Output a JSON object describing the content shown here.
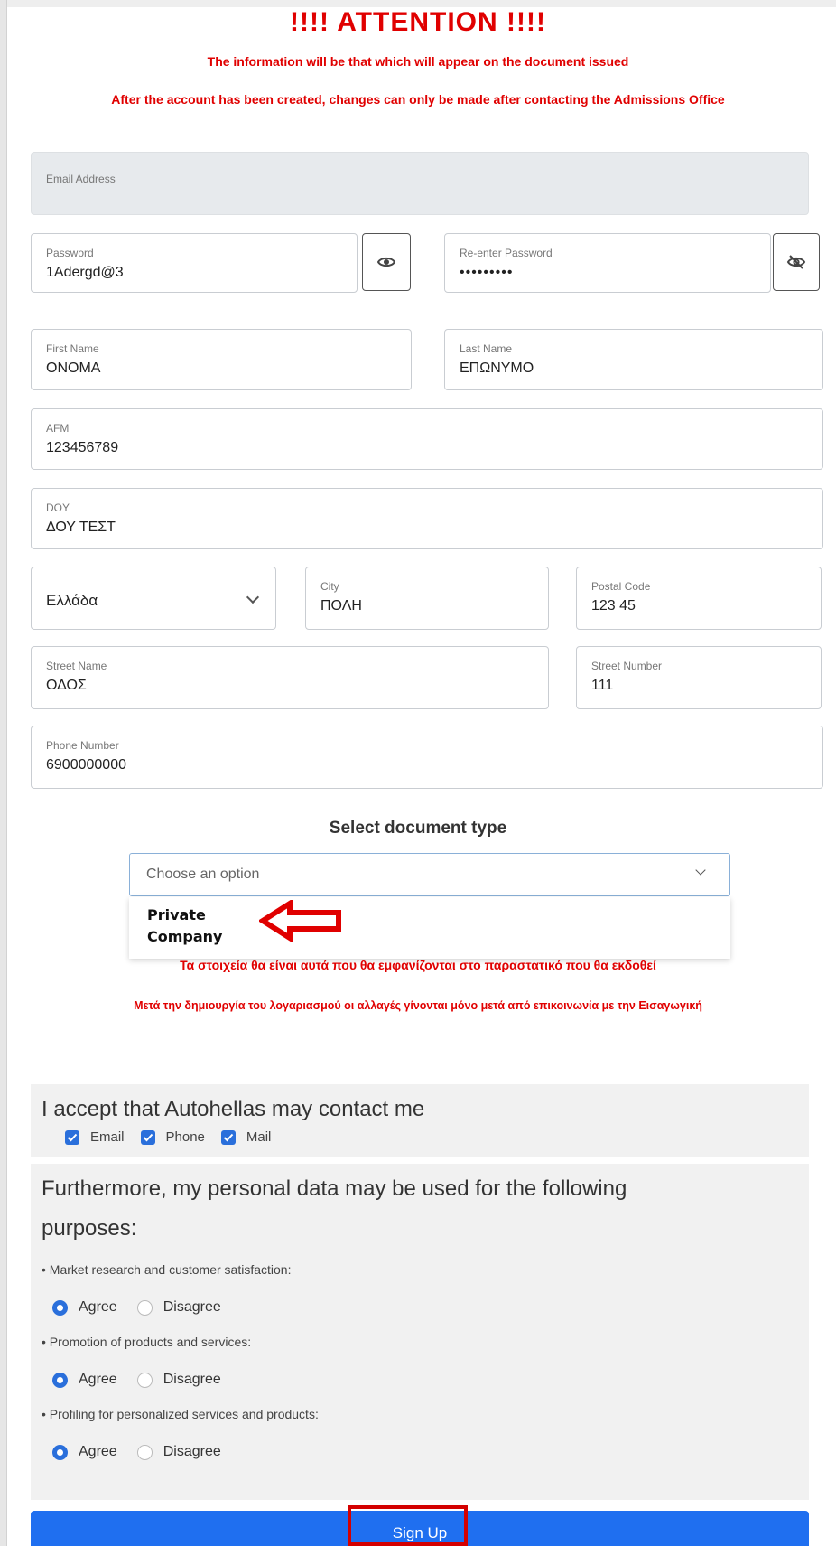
{
  "header": {
    "attention": "!!!!   ATTENTION   !!!!",
    "warning_info": "The information will be that which will appear on the document issued",
    "warning_changes": "After the account has been created, changes can only be made after contacting the Admissions Office"
  },
  "form": {
    "email": {
      "label": "Email Address",
      "value": ""
    },
    "password": {
      "label": "Password",
      "value": "1Adergd@3"
    },
    "reenter_password": {
      "label": "Re-enter Password",
      "value": "•••••••••"
    },
    "first_name": {
      "label": "First Name",
      "value": "ONOMA"
    },
    "last_name": {
      "label": "Last Name",
      "value": "ΕΠΩΝΥΜΟ"
    },
    "afm": {
      "label": "AFM",
      "value": "123456789"
    },
    "doy": {
      "label": "DOY",
      "value": "ΔΟΥ ΤΕΣΤ"
    },
    "country": {
      "value": "Ελλάδα"
    },
    "city": {
      "label": "City",
      "value": "ΠΟΛΗ"
    },
    "postal_code": {
      "label": "Postal Code",
      "value": "123 45"
    },
    "street_name": {
      "label": "Street Name",
      "value": "ΟΔΟΣ"
    },
    "street_number": {
      "label": "Street Number",
      "value": "111"
    },
    "phone": {
      "label": "Phone Number",
      "value": "6900000000"
    }
  },
  "document_type": {
    "title": "Select document type",
    "placeholder": "Choose an option",
    "option_line1": "Private",
    "option_line2": "Company"
  },
  "greek_warnings": {
    "line1": "Τα στοιχεία θα είναι αυτά που θα εμφανίζονται στο παραστατικό που θα εκδοθεί",
    "line2": "Μετά την δημιουργία του λογαριασμού οι αλλαγές γίνονται μόνο μετά από επικοινωνία με την Εισαγωγική"
  },
  "contact_consent": {
    "title": "I accept that Autohellas may contact me",
    "options": [
      "Email",
      "Phone",
      "Mail"
    ]
  },
  "data_usage": {
    "title_line1": "Furthermore, my personal data may be used for the following",
    "title_line2": "purposes:",
    "purposes": [
      {
        "label": "• Market research and customer satisfaction:",
        "agree": "Agree",
        "disagree": "Disagree"
      },
      {
        "label": "• Promotion of products and services:",
        "agree": "Agree",
        "disagree": "Disagree"
      },
      {
        "label": "• Profiling for personalized services and products:",
        "agree": "Agree",
        "disagree": "Disagree"
      }
    ]
  },
  "signup": {
    "label": "Sign Up"
  },
  "colors": {
    "accent": "#1f6ff0",
    "warning": "#e00000",
    "highlight": "#d40000"
  }
}
